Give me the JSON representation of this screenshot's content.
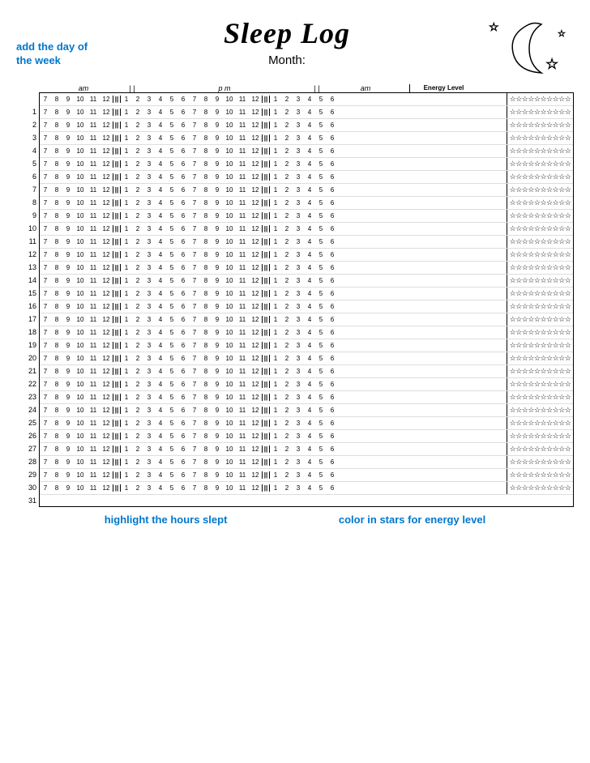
{
  "title": "Sleep Log",
  "add_day_label": "add the day of the week",
  "month_label": "Month:",
  "highlight_label": "highlight the hours slept",
  "stars_label": "color in stars for energy level",
  "energy_header": "Energy Level",
  "am_label": "am",
  "pm_label": "pm",
  "separator": "| |",
  "days": [
    "1",
    "2",
    "3",
    "4",
    "5",
    "6",
    "7",
    "8",
    "9",
    "10",
    "11",
    "12",
    "13",
    "14",
    "15",
    "16",
    "17",
    "18",
    "19",
    "20",
    "21",
    "22",
    "23",
    "24",
    "25",
    "26",
    "27",
    "28",
    "29",
    "30",
    "31"
  ],
  "hours_am1": [
    "7",
    "8",
    "9",
    "10",
    "11",
    "12"
  ],
  "hours_pm": [
    "1",
    "2",
    "3",
    "4",
    "5",
    "6",
    "7",
    "8",
    "9",
    "10",
    "11",
    "12"
  ],
  "hours_am2": [
    "1",
    "2",
    "3",
    "4",
    "5",
    "6"
  ],
  "stars_row": "☆☆☆☆☆☆☆"
}
